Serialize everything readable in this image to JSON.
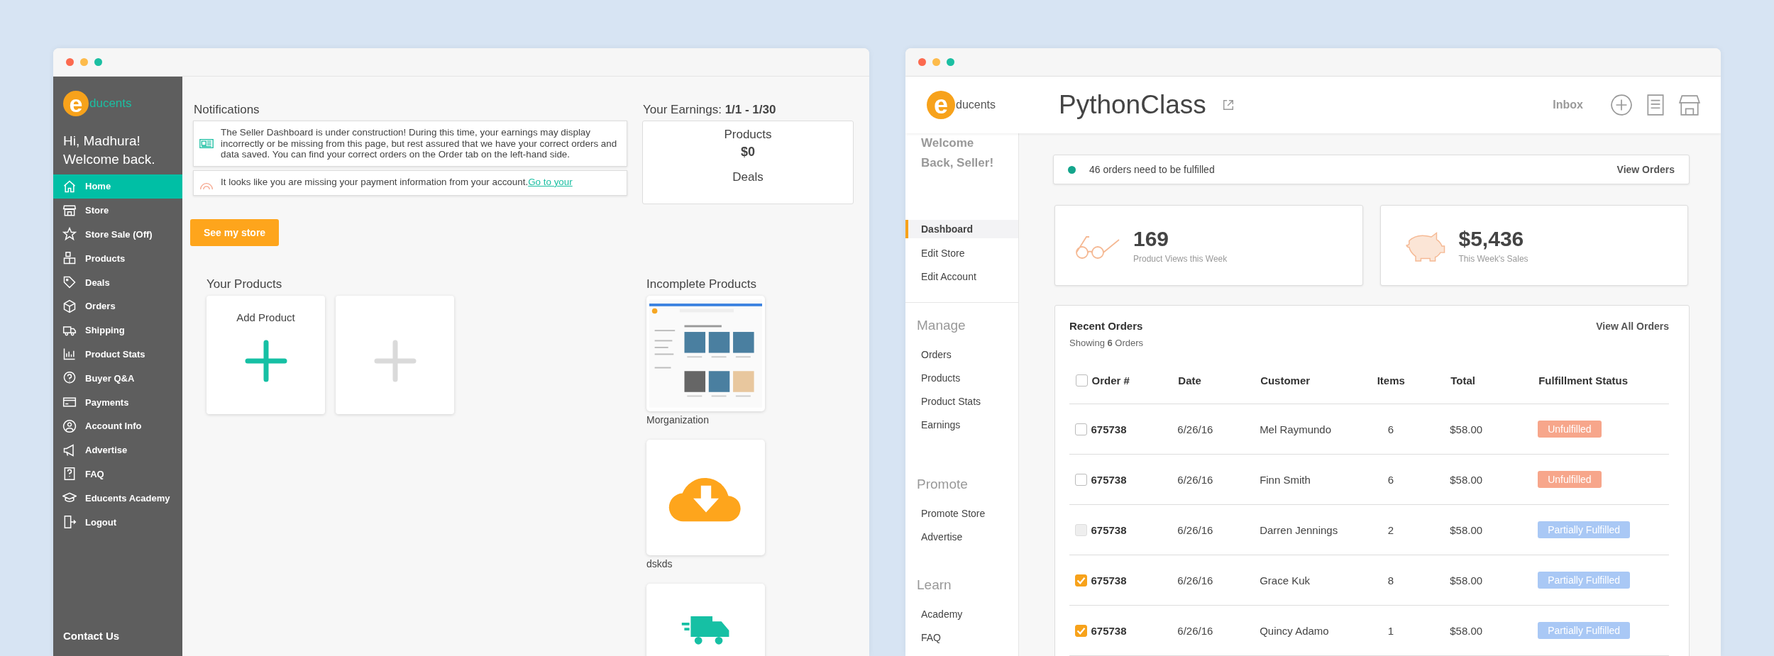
{
  "left_window": {
    "logo": {
      "mark": "e",
      "word": "ducents"
    },
    "sidebar": {
      "greeting": "Hi, Madhura!",
      "welcome": "Welcome back.",
      "items": [
        {
          "label": "Home",
          "selected": true
        },
        {
          "label": "Store",
          "selected": false
        },
        {
          "label": "Store Sale (Off)",
          "selected": false
        },
        {
          "label": "Products",
          "selected": false
        },
        {
          "label": "Deals",
          "selected": false
        },
        {
          "label": "Orders",
          "selected": false
        },
        {
          "label": "Shipping",
          "selected": false
        },
        {
          "label": "Product Stats",
          "selected": false
        },
        {
          "label": "Buyer Q&A",
          "selected": false
        },
        {
          "label": "Payments",
          "selected": false
        },
        {
          "label": "Account Info",
          "selected": false
        },
        {
          "label": "Advertise",
          "selected": false
        },
        {
          "label": "FAQ",
          "selected": false
        },
        {
          "label": "Educents Academy",
          "selected": false
        },
        {
          "label": "Logout",
          "selected": false
        }
      ],
      "footer": "Contact Us"
    },
    "notifications": {
      "title": "Notifications",
      "items": [
        {
          "kind": "info",
          "text": "The Seller Dashboard is under construction! During this time, your earnings may display incorrectly or be missing from this page, but rest assured that we have your correct orders and data saved. You can find your correct orders on the Order tab on the left-hand side."
        },
        {
          "kind": "warning",
          "text": "It looks like you are missing your payment information from your account.",
          "link": "Go to your"
        }
      ]
    },
    "earnings": {
      "title": "Your Earnings:",
      "range": "1/1 - 1/30",
      "items": [
        {
          "label": "Products",
          "value": "$0"
        },
        {
          "label": "Deals"
        }
      ]
    },
    "store_button": "See my store",
    "your_products": {
      "title": "Your Products",
      "cards": [
        {
          "label": "Add Product",
          "enabled": true
        },
        {
          "enabled": false
        }
      ]
    },
    "incomplete_products": {
      "title": "Incomplete Products",
      "items": [
        {
          "kind": "screenshot",
          "name": "Morganization"
        },
        {
          "kind": "upload",
          "name": "dskds"
        },
        {
          "kind": "shipping"
        }
      ]
    }
  },
  "right_window": {
    "logo": {
      "mark": "e",
      "word": "ducents"
    },
    "title": "PythonClass",
    "inbox": "Inbox",
    "sidebar": {
      "welcome": "Welcome Back, Seller!",
      "items": [
        {
          "label": "Dashboard",
          "selected": true
        },
        {
          "label": "Edit Store",
          "selected": false
        },
        {
          "label": "Edit Account",
          "selected": false
        }
      ],
      "sections": [
        {
          "heading": "Manage",
          "items": [
            "Orders",
            "Products",
            "Product Stats",
            "Earnings"
          ]
        },
        {
          "heading": "Promote",
          "items": [
            "Promote Store",
            "Advertise"
          ]
        },
        {
          "heading": "Learn",
          "items": [
            "Academy",
            "FAQ"
          ]
        }
      ]
    },
    "alert": {
      "text": "46 orders need to be fulfilled",
      "action": "View Orders"
    },
    "stats": [
      {
        "kind": "views",
        "value": "169",
        "label": "Product Views this Week"
      },
      {
        "kind": "sales",
        "value": "$5,436",
        "label": "This Week's Sales"
      }
    ],
    "orders": {
      "title": "Recent Orders",
      "showing": "Showing **6** Orders",
      "view_all": "View All Orders",
      "header_checked": false,
      "columns": [
        "Order #",
        "Date",
        "Customer",
        "Items",
        "Total",
        "Fulfillment Status"
      ],
      "rows": [
        {
          "order": "675738",
          "date": "6/26/16",
          "customer": "Mel Raymundo",
          "items": "6",
          "total": "$58.00",
          "status": "Unfulfilled",
          "color": "#f7a68b",
          "checked": false,
          "disabled": false
        },
        {
          "order": "675738",
          "date": "6/26/16",
          "customer": "Finn Smith",
          "items": "6",
          "total": "$58.00",
          "status": "Unfulfilled",
          "color": "#f7a68b",
          "checked": false,
          "disabled": false
        },
        {
          "order": "675738",
          "date": "6/26/16",
          "customer": "Darren Jennings",
          "items": "2",
          "total": "$58.00",
          "status": "Partially Fulfilled",
          "color": "#a9c8f5",
          "checked": false,
          "disabled": true
        },
        {
          "order": "675738",
          "date": "6/26/16",
          "customer": "Grace Kuk",
          "items": "8",
          "total": "$58.00",
          "status": "Partially Fulfilled",
          "color": "#a9c8f5",
          "checked": true,
          "disabled": false
        },
        {
          "order": "675738",
          "date": "6/26/16",
          "customer": "Quincy Adamo",
          "items": "1",
          "total": "$58.00",
          "status": "Partially Fulfilled",
          "color": "#a9c8f5",
          "checked": true,
          "disabled": false
        }
      ]
    }
  }
}
